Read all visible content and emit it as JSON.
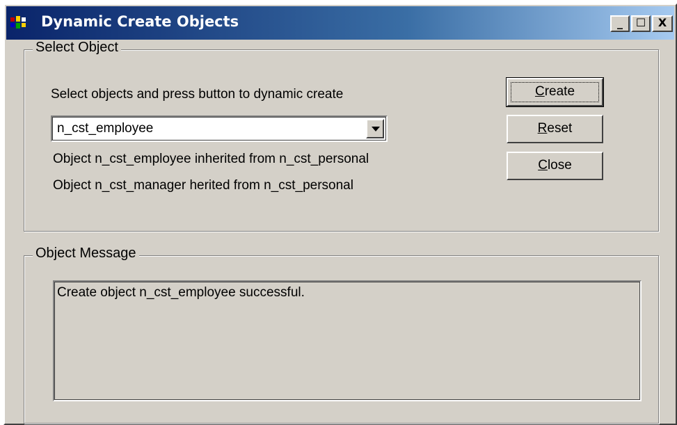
{
  "window": {
    "title": "Dynamic Create Objects",
    "min_glyph": "_",
    "max_glyph": "☐",
    "close_glyph": "X"
  },
  "select_group": {
    "label": "Select Object",
    "instruction": "Select objects and press button to dynamic create",
    "combo_value": "n_cst_employee",
    "info_lines": [
      "Object n_cst_employee inherited from n_cst_personal",
      "Object n_cst_manager herited from n_cst_personal"
    ]
  },
  "buttons": {
    "create": {
      "mnemonic": "C",
      "rest": "reate"
    },
    "reset": {
      "mnemonic": "R",
      "rest": "eset"
    },
    "close": {
      "mnemonic": "C",
      "rest": "lose"
    }
  },
  "message_group": {
    "label": "Object Message",
    "text": "Create object n_cst_employee successful."
  },
  "icons": {
    "app": "app-icon",
    "dropdown": "chevron-down-icon"
  }
}
